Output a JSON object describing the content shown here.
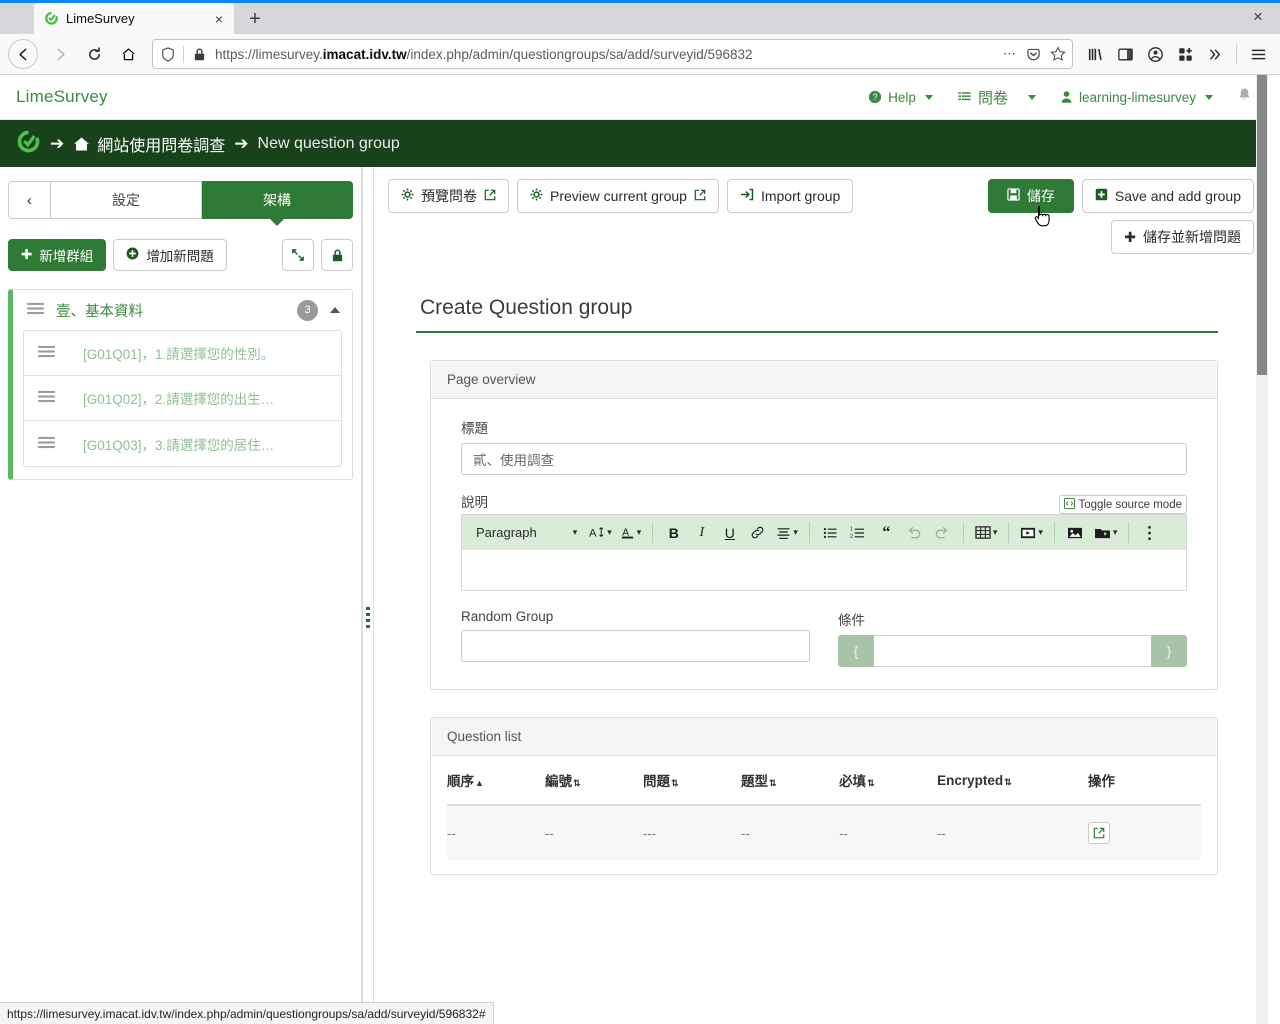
{
  "browser": {
    "tab": {
      "title": "LimeSurvey",
      "favicon": "limesurvey-icon",
      "close": "×"
    },
    "newtab_label": "+",
    "window_close": "×",
    "url_prefix": "https://limesurvey.",
    "url_domain": "imacat.idv.tw",
    "url_suffix": "/index.php/admin/questiongroups/sa/add/surveyid/596832",
    "nav": {
      "back": "back-arrow",
      "forward": "forward-arrow",
      "reload": "reload-arrow",
      "home": "home-icon"
    },
    "url_icons": [
      "shield-icon",
      "padlock-icon"
    ],
    "url_actions": [
      "ellipsis-icon",
      "pocket-icon",
      "star-icon"
    ],
    "toolbar_icons": [
      "library-icon",
      "sidebar-icon",
      "account-icon",
      "extensions-icon",
      "overflow-icon",
      "menu-icon"
    ],
    "status_url": "https://limesurvey.imacat.idv.tw/index.php/admin/questiongroups/sa/add/surveyid/596832#"
  },
  "topnav": {
    "brand": "LimeSurvey",
    "help": "Help",
    "surveys": "問卷",
    "user": "learning-limesurvey",
    "bell": "bell-icon"
  },
  "breadcrumb": {
    "home": "網站使用問卷調查",
    "current": "New question group",
    "arrow": "➔"
  },
  "sidebar": {
    "tabs": [
      {
        "label": "設定",
        "active": false
      },
      {
        "label": "架構",
        "active": true
      }
    ],
    "collapse_arrow": "‹",
    "actions": {
      "add_group": "新增群組",
      "add_question": "增加新問題",
      "collapse_icon": "collapse-arrows-icon",
      "lock_icon": "lock-icon"
    },
    "group": {
      "title": "壹、基本資料",
      "count": "3",
      "questions": [
        "[G01Q01]，1.請選擇您的性別。",
        "[G01Q02]，2.請選擇您的出生…",
        "[G01Q03]，3.請選擇您的居住…"
      ]
    }
  },
  "toolbar": {
    "preview_survey": "預覽問卷",
    "preview_group": "Preview current group",
    "import_group": "Import group",
    "save": "儲存",
    "save_and_add_group": "Save and add group",
    "save_and_add_question": "儲存並新增問題"
  },
  "main": {
    "page_title": "Create Question group",
    "overview_panel": {
      "heading": "Page overview",
      "title_label": "標題",
      "title_value": "貳、使用調查",
      "desc_label": "說明",
      "toggle_source": "Toggle source mode",
      "editor": {
        "paragraph": "Paragraph",
        "font_size": "font-size-icon",
        "font_color": "font-color-icon",
        "bold": "B",
        "italic": "I",
        "underline": "U",
        "link": "link-icon",
        "align": "align-icon",
        "bullet_list": "bullet-list-icon",
        "numbered_list": "numbered-list-icon",
        "blockquote": "“",
        "undo": "undo-icon",
        "redo": "redo-icon",
        "table": "table-icon",
        "media": "media-icon",
        "image": "image-icon",
        "file_browser": "file-browser-icon",
        "more": "kebab-icon",
        "content": ""
      },
      "random_group_label": "Random Group",
      "random_group_value": "",
      "condition_label": "條件",
      "condition_prefix": "{",
      "condition_suffix": "}",
      "condition_value": ""
    },
    "question_list": {
      "heading": "Question list",
      "columns": [
        {
          "label": "順序",
          "sort": "▲"
        },
        {
          "label": "編號",
          "sort": "⇅"
        },
        {
          "label": "問題",
          "sort": "⇅"
        },
        {
          "label": "題型",
          "sort": "⇅"
        },
        {
          "label": "必填",
          "sort": "⇅"
        },
        {
          "label": "Encrypted",
          "sort": "⇅"
        },
        {
          "label": "操作",
          "sort": ""
        }
      ],
      "rows": [
        {
          "cells": [
            "--",
            "--",
            "---",
            "--",
            "--",
            "--"
          ],
          "action_icon": "external-link-icon"
        }
      ]
    }
  },
  "colors": {
    "brand_green": "#3c8a3f",
    "dark_green": "#17421a",
    "button_green": "#2f7a34",
    "editor_toolbar": "#d8ecd8",
    "tab_blue": "#0a84ff"
  }
}
